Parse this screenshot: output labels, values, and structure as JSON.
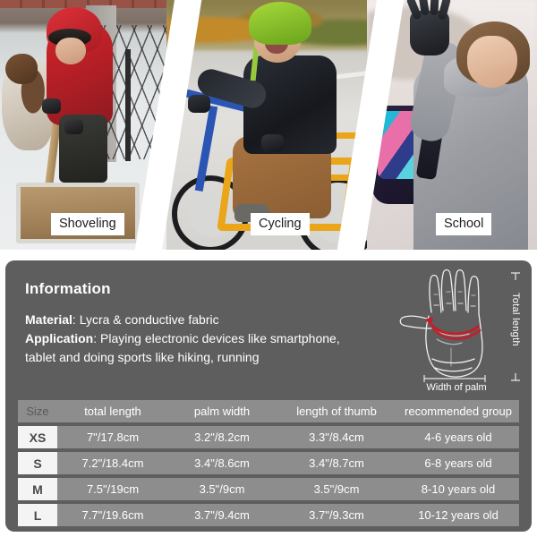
{
  "photos": [
    {
      "caption": "Shoveling",
      "scene": "child-shoveling-snow"
    },
    {
      "caption": "Cycling",
      "scene": "boy-riding-bicycle"
    },
    {
      "caption": "School",
      "scene": "girl-waving-with-backpack"
    }
  ],
  "info": {
    "title": "Information",
    "material_label": "Material",
    "material_value": ": Lycra & conductive fabric",
    "application_label": "Application",
    "application_value": ": Playing electronic devices like smartphone,",
    "application_value_2": "tablet and doing sports like hiking, running"
  },
  "diagram": {
    "total_length_label": "Total length",
    "width_label": "Width of palm",
    "top_cap": "⊤",
    "bottom_cap": "⊥"
  },
  "table": {
    "headers": [
      "Size",
      "total length",
      "palm width",
      "length of thumb",
      "recommended group"
    ],
    "rows": [
      {
        "size": "XS",
        "total_length": "7\"/17.8cm",
        "palm_width": "3.2\"/8.2cm",
        "thumb": "3.3\"/8.4cm",
        "group": "4-6 years old"
      },
      {
        "size": "S",
        "total_length": "7.2\"/18.4cm",
        "palm_width": "3.4\"/8.6cm",
        "thumb": "3.4\"/8.7cm",
        "group": "6-8 years old"
      },
      {
        "size": "M",
        "total_length": "7.5\"/19cm",
        "palm_width": "3.5\"/9cm",
        "thumb": "3.5\"/9cm",
        "group": "8-10  years old"
      },
      {
        "size": "L",
        "total_length": "7.7\"/19.6cm",
        "palm_width": "3.7\"/9.4cm",
        "thumb": "3.7\"/9.3cm",
        "group": "10-12 years old"
      }
    ]
  },
  "colors": {
    "panel_bg": "#5e5e5e",
    "row_bg": "#8d8d8d",
    "size_cell_bg": "#f4f4f4",
    "accent_red": "#c0202a",
    "page_bg": "#ffffff"
  }
}
